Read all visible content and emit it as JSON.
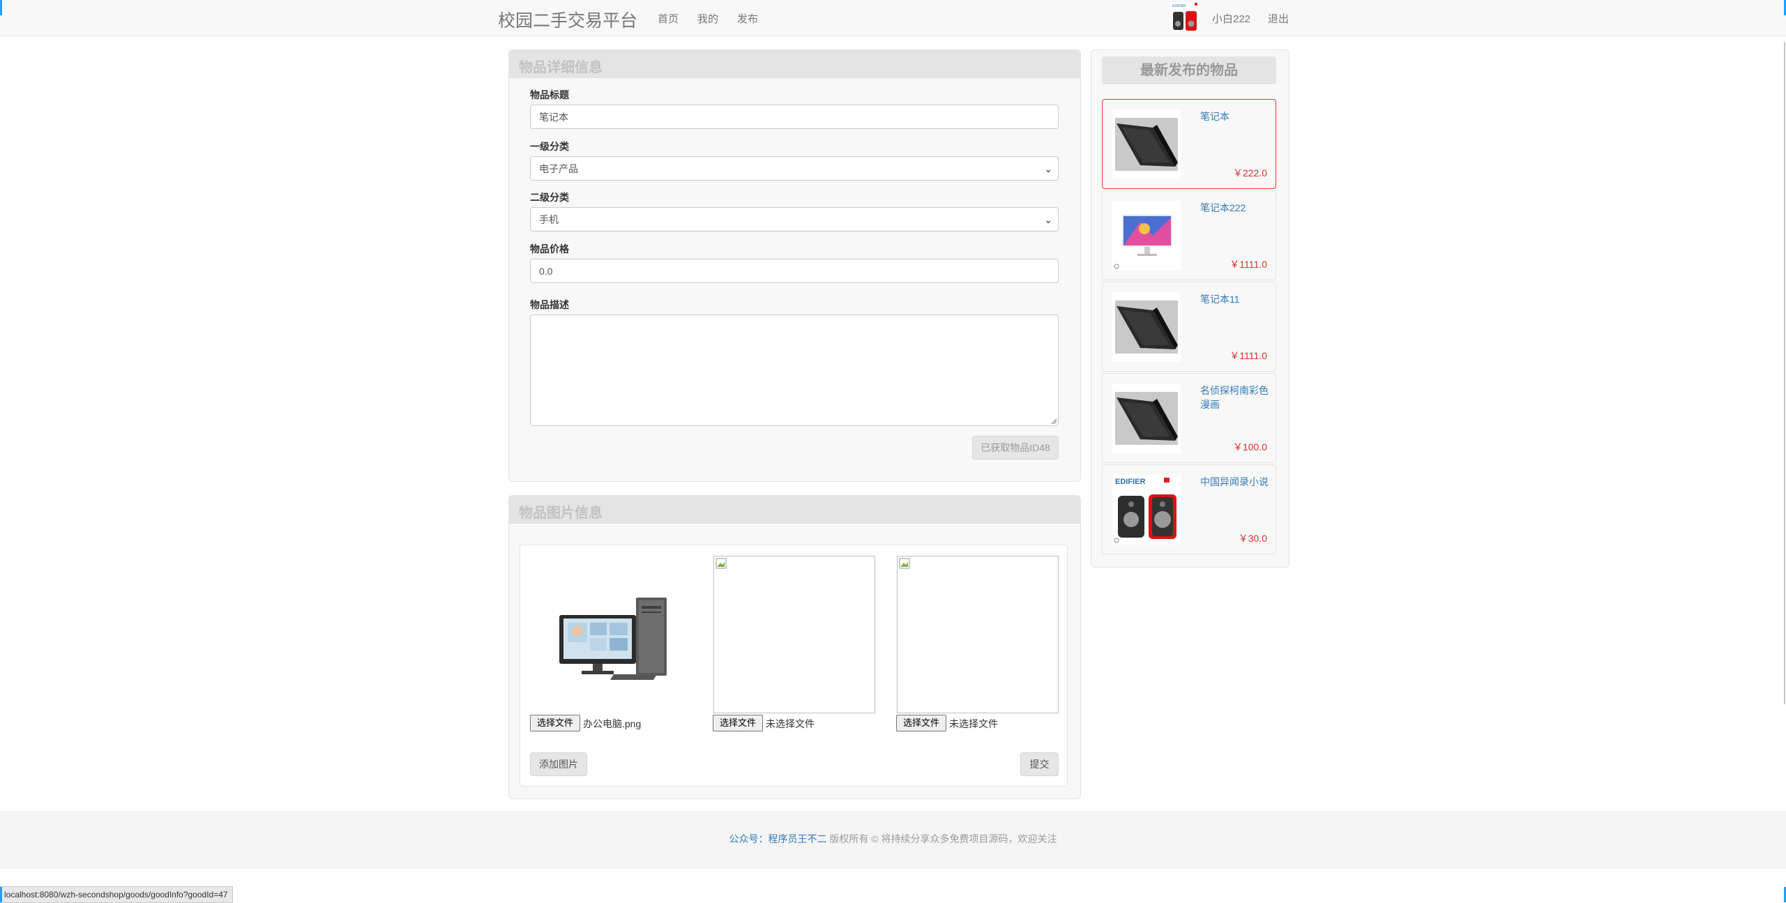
{
  "navbar": {
    "brand": "校园二手交易平台",
    "links": [
      "首页",
      "我的",
      "发布"
    ],
    "username": "小白222",
    "logout": "退出"
  },
  "detail": {
    "heading": "物品详细信息",
    "title_label": "物品标题",
    "title_value": "笔记本",
    "cat1_label": "一级分类",
    "cat1_value": "电子产品",
    "cat2_label": "二级分类",
    "cat2_value": "手机",
    "price_label": "物品价格",
    "price_value": "0.0",
    "desc_label": "物品描述",
    "desc_value": "",
    "id_button": "已获取物品ID48"
  },
  "images": {
    "heading": "物品图片信息",
    "slots": [
      {
        "button": "选择文件",
        "filename": "办公电脑.png"
      },
      {
        "button": "选择文件",
        "filename": "未选择文件"
      },
      {
        "button": "选择文件",
        "filename": "未选择文件"
      }
    ],
    "add_button": "添加图片",
    "submit_button": "提交"
  },
  "recent": {
    "heading": "最新发布的物品",
    "items": [
      {
        "title": "笔记本",
        "price": "￥222.0",
        "thumb": "laptop-image"
      },
      {
        "title": "笔记本222",
        "price": "￥1111.0",
        "thumb": "monitor-image"
      },
      {
        "title": "笔记本11",
        "price": "￥1111.0",
        "thumb": "laptop-image"
      },
      {
        "title": "名侦探柯南彩色漫画",
        "price": "￥100.0",
        "thumb": "laptop-image"
      },
      {
        "title": "中国异闻录小说",
        "price": "￥30.0",
        "thumb": "speaker-image"
      }
    ]
  },
  "footer": {
    "prefix": "公众号：",
    "link": "程序员王不二",
    "suffix": " 版权所有 © 将持续分享众多免费项目源码，欢迎关注"
  },
  "status_url": "localhost:8080/wzh-secondshop/goods/goodInfo?goodId=47",
  "colors": {
    "accent": "#337ab7",
    "price": "#d9302e",
    "active_border": "#e33333"
  }
}
